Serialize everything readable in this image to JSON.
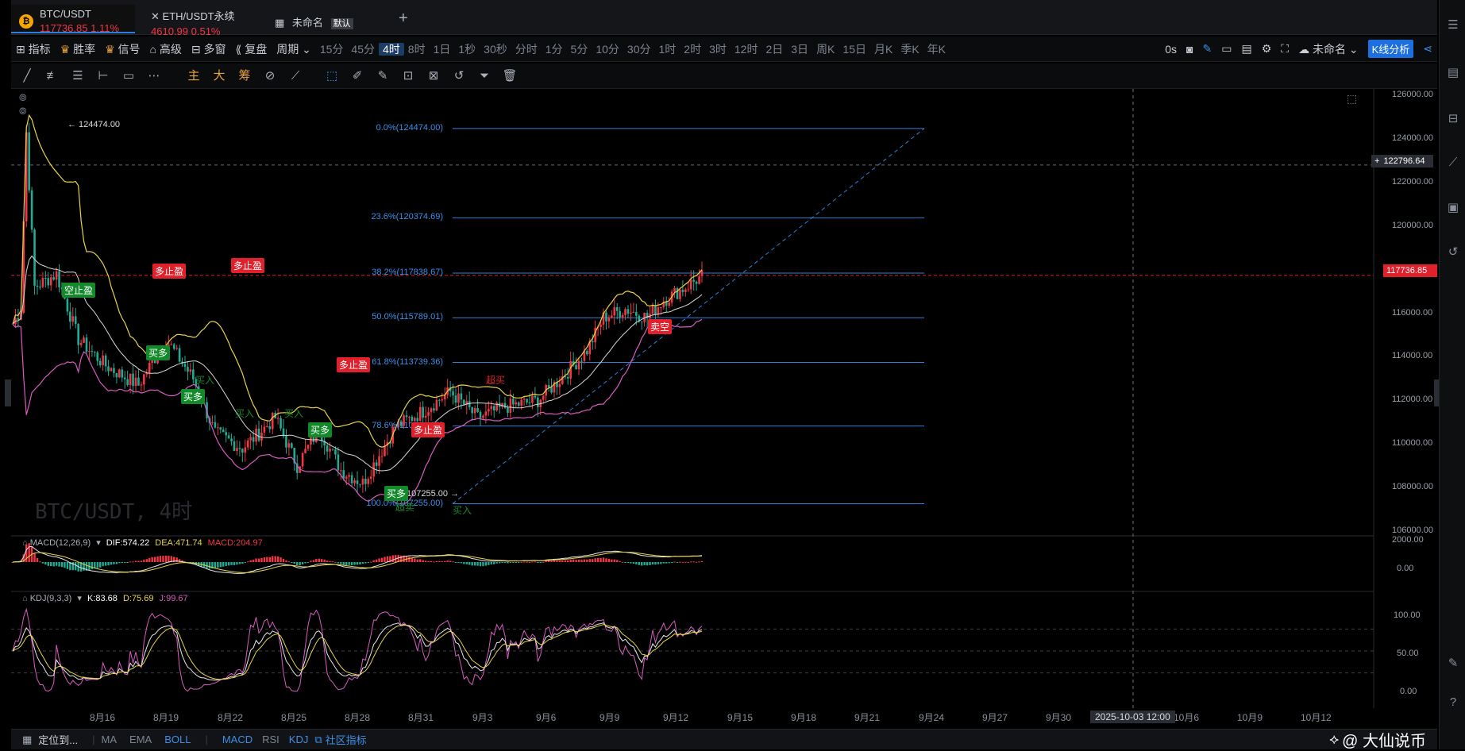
{
  "tabs": [
    {
      "symbol": "BTC/USDT",
      "price": "117736.85",
      "change": "1.11%",
      "active": true
    },
    {
      "symbol": "ETH/USDT永续",
      "price": "4610.99",
      "change": "0.51%",
      "active": false
    },
    {
      "symbol": "未命名",
      "badge": "默认",
      "active": false
    }
  ],
  "new_tab_icon": "plus-icon",
  "toolbar": {
    "indicator": "指标",
    "winrate": "胜率",
    "signal": "信号",
    "advanced": "高级",
    "multi": "多窗",
    "replay": "复盘",
    "period": "周期",
    "periods": [
      "15分",
      "45分",
      "4时",
      "8时",
      "1日",
      "1秒",
      "30秒",
      "分时",
      "1分",
      "5分",
      "10分",
      "30分",
      "1时",
      "2时",
      "3时",
      "12时",
      "2日",
      "3日",
      "周K",
      "15日",
      "月K",
      "季K",
      "年K"
    ],
    "selected_period": "4时",
    "latency": "0s",
    "layout_name": "未命名",
    "kline_analysis": "K线分析"
  },
  "draw_tools": {
    "main": "主",
    "big": "大",
    "chips": "筹"
  },
  "chart": {
    "watermark": "BTC/USDT, 4时",
    "high_label": "← 124474.00",
    "low_label": "107255.00 →",
    "crosshair_price": "122796.64",
    "last_price": "117736.85",
    "crosshair_date": "2025-10-03 12:00",
    "fib_levels": [
      {
        "label": "0.0%(124474.00)",
        "value": 124474.0
      },
      {
        "label": "23.6%(120374.69)",
        "value": 120374.69
      },
      {
        "label": "38.2%(117838.67)",
        "value": 117838.67
      },
      {
        "label": "50.0%(115789.01)",
        "value": 115789.01
      },
      {
        "label": "61.8%(113739.36)",
        "value": 113739.36
      },
      {
        "label": "78.6%(110821.20)",
        "value": 110821.2
      },
      {
        "label": "100.0%(107255.00)",
        "value": 107255.0
      }
    ],
    "y_ticks": [
      "126000.00",
      "124000.00",
      "122000.00",
      "120000.00",
      "118000.00",
      "116000.00",
      "114000.00",
      "112000.00",
      "110000.00",
      "108000.00",
      "106000.00"
    ],
    "x_ticks": [
      "8月16",
      "8月19",
      "8月22",
      "8月25",
      "8月28",
      "8月31",
      "9月3",
      "9月6",
      "9月9",
      "9月12",
      "9月15",
      "9月18",
      "9月21",
      "9月24",
      "9月27",
      "9月30",
      "10月3",
      "10月6",
      "10月9",
      "10月12"
    ],
    "signals": [
      {
        "text": "空止盈",
        "style": "g"
      },
      {
        "text": "多止盈",
        "style": "r"
      },
      {
        "text": "多止盈",
        "style": "r"
      },
      {
        "text": "买多",
        "style": "g"
      },
      {
        "text": "买多",
        "style": "g"
      },
      {
        "text": "买多",
        "style": "g"
      },
      {
        "text": "多止盈",
        "style": "r"
      },
      {
        "text": "多止盈",
        "style": "r"
      },
      {
        "text": "卖空",
        "style": "r"
      },
      {
        "text": "买多",
        "style": "g"
      }
    ],
    "signal_texts": [
      {
        "text": "买入",
        "color": "green"
      },
      {
        "text": "买入",
        "color": "green"
      },
      {
        "text": "买入",
        "color": "green"
      },
      {
        "text": "买入",
        "color": "green"
      },
      {
        "text": "超卖",
        "color": "green"
      },
      {
        "text": "超买",
        "color": "red"
      }
    ]
  },
  "macd": {
    "name": "MACD(12,26,9)",
    "dif": "DIF:574.22",
    "dea": "DEA:471.74",
    "macd": "MACD:204.97",
    "y_ticks": [
      "2000.00",
      "0.00"
    ]
  },
  "kdj": {
    "name": "KDJ(9,3,3)",
    "k": "K:83.68",
    "d": "D:75.69",
    "j": "J:99.67",
    "y_ticks": [
      "100.00",
      "50.00",
      "0.00"
    ]
  },
  "status": {
    "locate": "定位到...",
    "ma": "MA",
    "ema": "EMA",
    "boll": "BOLL",
    "macd": "MACD",
    "rsi": "RSI",
    "kdj": "KDJ",
    "community": "社区指标",
    "watermark": "@ 大仙说币"
  },
  "colors": {
    "up": "#f23645",
    "down": "#22ab94",
    "accent": "#2b7fe0",
    "fib": "#2f7fd8",
    "boll_upper": "#e8d44a",
    "boll_mid": "#d8d8d8",
    "boll_lower": "#d85cc0"
  }
}
